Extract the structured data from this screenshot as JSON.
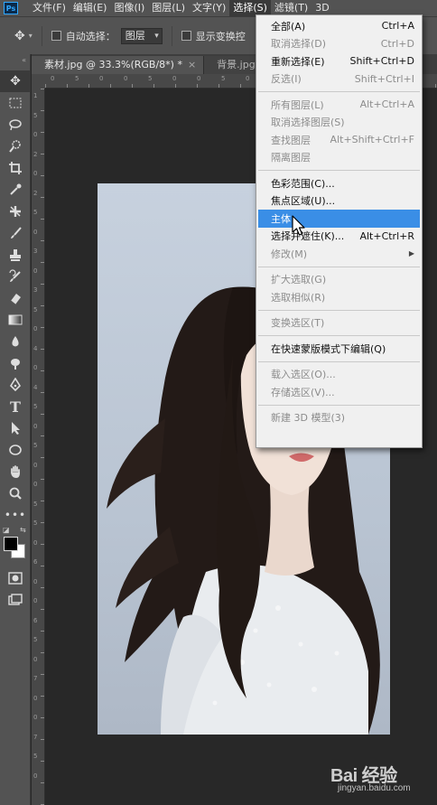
{
  "app": {
    "logo": "Ps"
  },
  "menubar": {
    "items": [
      {
        "label": "文件(F)"
      },
      {
        "label": "编辑(E)"
      },
      {
        "label": "图像(I)"
      },
      {
        "label": "图层(L)"
      },
      {
        "label": "文字(Y)"
      },
      {
        "label": "选择(S)"
      },
      {
        "label": "滤镜(T)"
      },
      {
        "label": "3D"
      }
    ],
    "active_index": 5
  },
  "options_bar": {
    "auto_select_label": "自动选择：",
    "auto_select_value": "图层",
    "show_transform_label": "显示变换控"
  },
  "tabs": [
    {
      "label": "素材.jpg @ 33.3%(RGB/8*) *",
      "close": "×"
    },
    {
      "label": "背景.jpg @",
      "close": ""
    }
  ],
  "ruler": {
    "h_marks": [
      "0",
      "5",
      "0",
      "0",
      "5",
      "0",
      "0",
      "5",
      "0",
      "0",
      "5",
      "0",
      "0",
      "5",
      "0",
      "0"
    ],
    "v_marks": [
      "1",
      "5",
      "0",
      "2",
      "0",
      "2",
      "5",
      "0",
      "3",
      "0",
      "3",
      "5",
      "0",
      "4",
      "0",
      "4",
      "5",
      "0",
      "5",
      "0",
      "0",
      "5",
      "5",
      "0",
      "6",
      "0",
      "0",
      "6",
      "5",
      "0",
      "7",
      "0",
      "0",
      "7",
      "5",
      "0"
    ]
  },
  "select_menu": {
    "items": [
      {
        "type": "item",
        "label": "全部(A)",
        "shortcut": "Ctrl+A",
        "enabled": true
      },
      {
        "type": "item",
        "label": "取消选择(D)",
        "shortcut": "Ctrl+D",
        "enabled": false
      },
      {
        "type": "item",
        "label": "重新选择(E)",
        "shortcut": "Shift+Ctrl+D",
        "enabled": true
      },
      {
        "type": "item",
        "label": "反选(I)",
        "shortcut": "Shift+Ctrl+I",
        "enabled": false
      },
      {
        "type": "divider"
      },
      {
        "type": "item",
        "label": "所有图层(L)",
        "shortcut": "Alt+Ctrl+A",
        "enabled": false
      },
      {
        "type": "item",
        "label": "取消选择图层(S)",
        "shortcut": "",
        "enabled": false
      },
      {
        "type": "item",
        "label": "查找图层",
        "shortcut": "Alt+Shift+Ctrl+F",
        "enabled": false
      },
      {
        "type": "item",
        "label": "隔离图层",
        "shortcut": "",
        "enabled": false
      },
      {
        "type": "divider"
      },
      {
        "type": "item",
        "label": "色彩范围(C)...",
        "shortcut": "",
        "enabled": true
      },
      {
        "type": "item",
        "label": "焦点区域(U)...",
        "shortcut": "",
        "enabled": true
      },
      {
        "type": "item",
        "label": "主体",
        "shortcut": "",
        "enabled": true,
        "highlighted": true
      },
      {
        "type": "item",
        "label": "选择并遮住(K)...",
        "shortcut": "Alt+Ctrl+R",
        "enabled": true
      },
      {
        "type": "item",
        "label": "修改(M)",
        "shortcut": "",
        "enabled": false,
        "submenu": true
      },
      {
        "type": "divider"
      },
      {
        "type": "item",
        "label": "扩大选取(G)",
        "shortcut": "",
        "enabled": false
      },
      {
        "type": "item",
        "label": "选取相似(R)",
        "shortcut": "",
        "enabled": false
      },
      {
        "type": "divider"
      },
      {
        "type": "item",
        "label": "变换选区(T)",
        "shortcut": "",
        "enabled": false
      },
      {
        "type": "divider"
      },
      {
        "type": "item",
        "label": "在快速蒙版模式下编辑(Q)",
        "shortcut": "",
        "enabled": true
      },
      {
        "type": "divider"
      },
      {
        "type": "item",
        "label": "载入选区(O)...",
        "shortcut": "",
        "enabled": false
      },
      {
        "type": "item",
        "label": "存储选区(V)...",
        "shortcut": "",
        "enabled": false
      },
      {
        "type": "divider"
      },
      {
        "type": "item",
        "label": "新建 3D 模型(3)",
        "shortcut": "",
        "enabled": false
      }
    ]
  },
  "tools": [
    "move-tool-icon",
    "marquee-tool-icon",
    "lasso-tool-icon",
    "quick-select-tool-icon",
    "crop-tool-icon",
    "eyedropper-tool-icon",
    "healing-brush-tool-icon",
    "brush-tool-icon",
    "clone-stamp-tool-icon",
    "history-brush-tool-icon",
    "eraser-tool-icon",
    "gradient-tool-icon",
    "blur-tool-icon",
    "dodge-tool-icon",
    "pen-tool-icon",
    "type-tool-icon",
    "path-select-tool-icon",
    "ellipse-tool-icon",
    "hand-tool-icon",
    "zoom-tool-icon",
    "more-tools-icon"
  ],
  "colors": {
    "foreground": "#000000",
    "background": "#ffffff",
    "menu_highlight": "#3a8ee6",
    "chrome": "#535353",
    "workspace": "#282828"
  },
  "watermark": {
    "main": "Bai 经验",
    "sub": "jingyan.baidu.com"
  }
}
